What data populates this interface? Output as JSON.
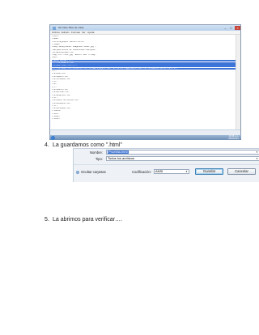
{
  "notepad": {
    "title": "Sin título: Bloc de notas",
    "menu": [
      "Archivo",
      "Edición",
      "Formato",
      "Ver",
      "Ayuda"
    ],
    "lines": [
      {
        "text": "<html>",
        "selected": false
      },
      {
        "text": "<head>",
        "selected": false
      },
      {
        "text": "<title>Ejemplo tabla</title>",
        "selected": false
      },
      {
        "text": "</head>",
        "selected": false
      },
      {
        "text": "<body background=\"imagenes/fondo.jpg\">",
        "selected": false
      },
      {
        "text": "<marquee>Fotos de vacaciones</marquee>",
        "selected": false
      },
      {
        "text": "<h1>Bienvenido</h1>",
        "selected": false
      },
      {
        "text": "<img src=\"foto.jpg\" width=\"200\"></img>",
        "selected": false
      },
      {
        "text": "<div>",
        "selected": false
      },
      {
        "text": "<table border=\"1\">",
        "selected": true
      },
      {
        "text": "<tr><td>Nombre</td>",
        "selected": true
      },
      {
        "text": "<td>Apellido</td></tr>",
        "selected": true
      },
      {
        "text": "<tr><td>Juan</td><td>Perez</td><td>www.ejemplo.com</td><td>correo@ejemplo.com</td><td>Buenos Aires</td></tr>",
        "selected": true
      },
      {
        "text": "<tr>",
        "selected": false
      },
      {
        "text": "<td>Ana</td>",
        "selected": false
      },
      {
        "text": "<td>Lopez</td>",
        "selected": false
      },
      {
        "text": "<td>Córdoba</td>",
        "selected": false
      },
      {
        "text": "</tr>",
        "selected": false
      },
      {
        "text": "<td>",
        "selected": false
      },
      {
        "text": "<tr>",
        "selected": false
      },
      {
        "text": "<td>Pedro</td>",
        "selected": false
      },
      {
        "text": "<td>Garcia</td>",
        "selected": false
      },
      {
        "text": "<td>Rosario</td>",
        "selected": false
      },
      {
        "text": "</tr>",
        "selected": false
      },
      {
        "text": "<td>Pablo de Maria</td>",
        "selected": false
      },
      {
        "text": "<td>Mendoza</td>",
        "selected": false
      },
      {
        "text": "</tr>",
        "selected": false
      },
      {
        "text": "<td>Mariana</td>",
        "selected": false
      },
      {
        "text": "</table>",
        "selected": false
      },
      {
        "text": "</div>",
        "selected": false
      },
      {
        "text": "</body>",
        "selected": false
      },
      {
        "text": "</html>",
        "selected": false
      }
    ]
  },
  "taskbar": {
    "time": "08:38 p.m.",
    "date": "28/09/2011"
  },
  "steps": [
    {
      "number": "4.",
      "text": "La guardamos como \".html\""
    },
    {
      "number": "5.",
      "text": "La abrimos para verificar…."
    }
  ],
  "save_dialog": {
    "name_label": "Nombre:",
    "name_value": "Pruebita.html",
    "type_label": "Tipo:",
    "type_value": "Todos los archivos",
    "hide_folders_label": "Ocultar carpetas",
    "encoding_label": "Codificación:",
    "encoding_value": "ANSI",
    "save_label": "Guardar",
    "cancel_label": "Cancelar"
  }
}
